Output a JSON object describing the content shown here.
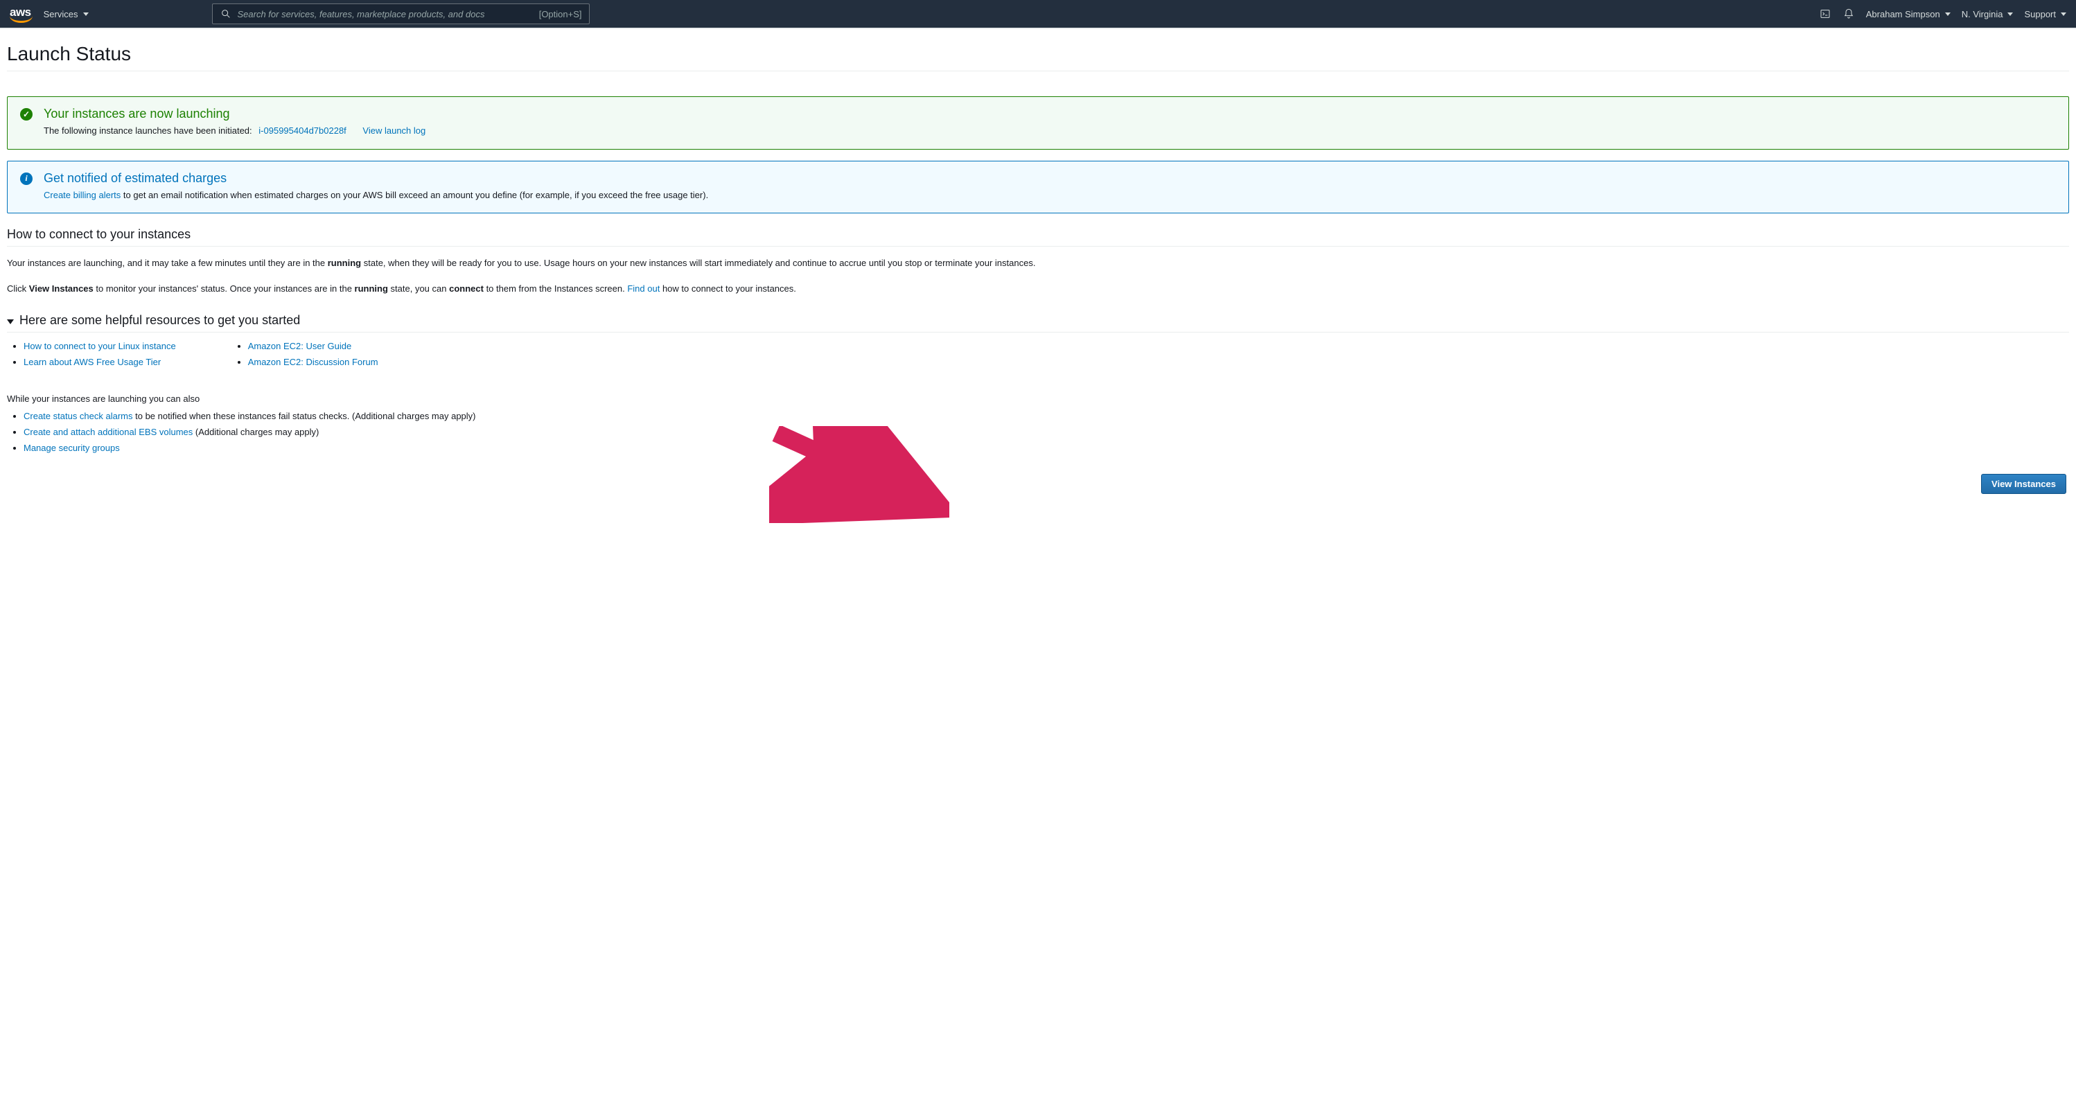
{
  "nav": {
    "services": "Services",
    "search_placeholder": "Search for services, features, marketplace products, and docs",
    "search_shortcut": "[Option+S]",
    "account": "Abraham Simpson",
    "region": "N. Virginia",
    "support": "Support"
  },
  "page_title": "Launch Status",
  "alert_success": {
    "heading": "Your instances are now launching",
    "body_prefix": "The following instance launches have been initiated:",
    "instance_id": "i-095995404d7b0228f",
    "view_log": "View launch log"
  },
  "alert_info": {
    "heading": "Get notified of estimated charges",
    "link": "Create billing alerts",
    "body_suffix": "to get an email notification when estimated charges on your AWS bill exceed an amount you define (for example, if you exceed the free usage tier)."
  },
  "connect_section": {
    "title": "How to connect to your instances",
    "p1_a": "Your instances are launching, and it may take a few minutes until they are in the ",
    "p1_b_bold": "running",
    "p1_c": " state, when they will be ready for you to use. Usage hours on your new instances will start immediately and continue to accrue until you stop or terminate your instances.",
    "p2_a": "Click ",
    "p2_b_bold": "View Instances",
    "p2_c": " to monitor your instances' status. Once your instances are in the ",
    "p2_d_bold": "running",
    "p2_e": " state, you can ",
    "p2_f_bold": "connect",
    "p2_g": " to them from the Instances screen. ",
    "p2_link": "Find out",
    "p2_h": " how to connect to your instances."
  },
  "resources": {
    "heading": "Here are some helpful resources to get you started",
    "col1": [
      "How to connect to your Linux instance",
      "Learn about AWS Free Usage Tier"
    ],
    "col2": [
      "Amazon EC2: User Guide",
      "Amazon EC2: Discussion Forum"
    ]
  },
  "while_launching": {
    "intro": "While your instances are launching you can also",
    "items": [
      {
        "link": "Create status check alarms",
        "rest": " to be notified when these instances fail status checks. (Additional charges may apply)"
      },
      {
        "link": "Create and attach additional EBS volumes",
        "rest": " (Additional charges may apply)"
      },
      {
        "link": "Manage security groups",
        "rest": ""
      }
    ]
  },
  "footer_button": "View Instances"
}
